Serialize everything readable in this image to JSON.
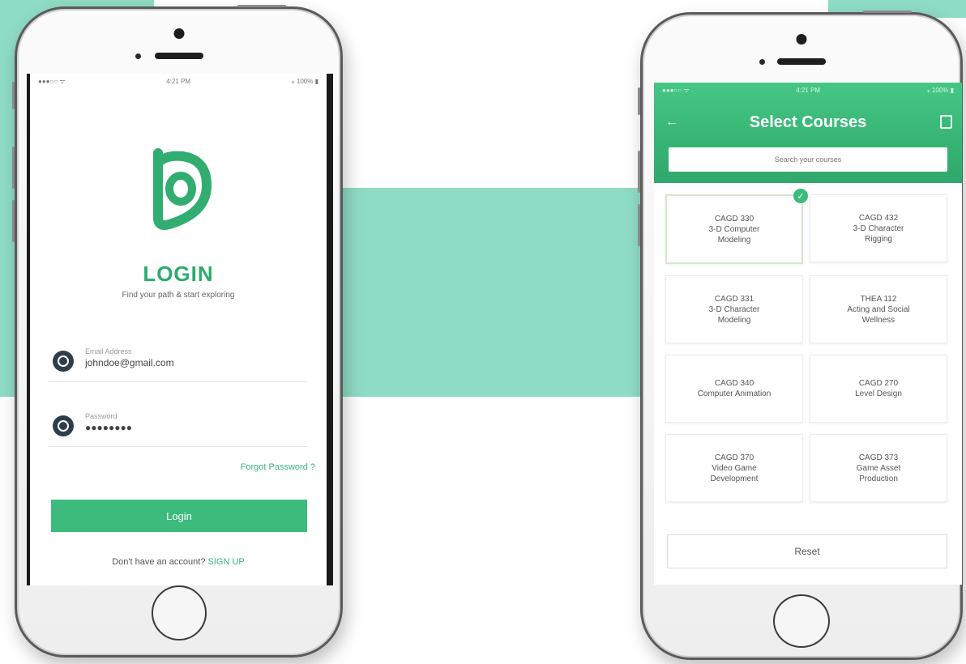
{
  "login_screen": {
    "status": {
      "left": "●●●○○ ᯤ",
      "time": "4:21 PM",
      "right": "⁎ 100% ▮"
    },
    "title": "LOGIN",
    "subtitle": "Find your path & start exploring",
    "email": {
      "label": "Email Address",
      "value": "johndoe@gmail.com"
    },
    "password": {
      "label": "Password",
      "value": "●●●●●●●●"
    },
    "forgot_label": "Forgot Password ?",
    "login_label": "Login",
    "signup_prompt": "Don't have an account?",
    "signup_link": "SIGN UP",
    "colors": {
      "accent": "#3dbb7c",
      "dark_icon": "#2f3d4a"
    }
  },
  "courses_screen": {
    "status": {
      "left": "●●●○○ ᯤ",
      "time": "4:21 PM",
      "right": "⁎ 100% ▮"
    },
    "title": "Select Courses",
    "search_placeholder": "Search your courses",
    "courses": [
      {
        "text": "CAGD 330\n3-D Computer\nModeling",
        "selected": true
      },
      {
        "text": "CAGD 432\n3-D Character\nRigging",
        "selected": false
      },
      {
        "text": "CAGD 331\n3-D Character\nModeling",
        "selected": false
      },
      {
        "text": "THEA 112\nActing and Social\nWellness",
        "selected": false
      },
      {
        "text": "CAGD 340\nComputer Animation",
        "selected": false
      },
      {
        "text": "CAGD 270\nLevel Design",
        "selected": false
      },
      {
        "text": "CAGD 370\nVideo Game\nDevelopment",
        "selected": false
      },
      {
        "text": "CAGD 373\nGame Asset\nProduction",
        "selected": false
      }
    ],
    "reset_label": "Reset",
    "colors": {
      "header": "#3dbb7c"
    }
  },
  "colors": {
    "background_accent": "#8fdcc4"
  }
}
